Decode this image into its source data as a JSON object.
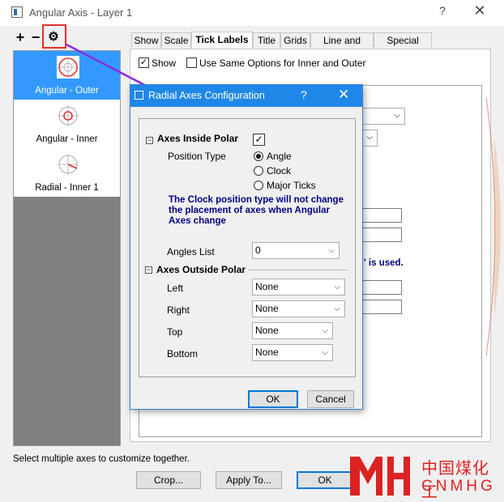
{
  "window": {
    "title": "Angular Axis - Layer 1",
    "help_label": "?",
    "close_label": "✕"
  },
  "toolbar": {
    "add_label": "+",
    "remove_label": "−",
    "settings_label": "⚙"
  },
  "axis_list": {
    "items": [
      {
        "label": "Angular - Outer",
        "icon": "angular-outer-icon",
        "selected": true
      },
      {
        "label": "Angular - Inner",
        "icon": "angular-inner-icon",
        "selected": false
      },
      {
        "label": "Radial - Inner 1",
        "icon": "radial-inner-icon",
        "selected": false
      }
    ]
  },
  "tabs": [
    {
      "label": "Show",
      "active": false
    },
    {
      "label": "Scale",
      "active": false
    },
    {
      "label": "Tick Labels",
      "active": true
    },
    {
      "label": "Title",
      "active": false
    },
    {
      "label": "Grids",
      "active": false
    },
    {
      "label": "Line and Ticks",
      "active": false
    },
    {
      "label": "Special Ticks",
      "active": false
    }
  ],
  "panel": {
    "show_label": "Show",
    "show_checked": true,
    "same_options_label": "Use Same Options for Inner and Outer",
    "same_options_checked": false,
    "hint_fragment": "' is used."
  },
  "status_text": "Select multiple axes to customize together.",
  "buttons": {
    "crop": "Crop...",
    "apply_to": "Apply To...",
    "ok": "OK"
  },
  "dialog": {
    "title": "Radial Axes Configuration",
    "help_label": "?",
    "close_label": "✕",
    "inside": {
      "header": "Axes Inside Polar",
      "checked": true,
      "position_type_label": "Position Type",
      "options": [
        {
          "label": "Angle",
          "selected": true
        },
        {
          "label": "Clock",
          "selected": false
        },
        {
          "label": "Major Ticks",
          "selected": false
        }
      ],
      "note": "The Clock position type will not change the placement of axes when Angular Axes change",
      "angles_list_label": "Angles List",
      "angles_list_value": "0"
    },
    "outside": {
      "header": "Axes Outside Polar",
      "rows": [
        {
          "label": "Left",
          "value": "None"
        },
        {
          "label": "Right",
          "value": "None"
        },
        {
          "label": "Top",
          "value": "None"
        },
        {
          "label": "Bottom",
          "value": "None"
        }
      ]
    },
    "ok_label": "OK",
    "cancel_label": "Cancel"
  },
  "watermark": {
    "cn_text": "中国煤化工",
    "en_text": "CNMHG"
  },
  "colors": {
    "selection": "#3399ff",
    "dialog_title": "#1f87e8",
    "note_text": "#000080",
    "highlight": "#e03030",
    "arrow": "#8a2be2",
    "watermark": "#dd2222"
  }
}
